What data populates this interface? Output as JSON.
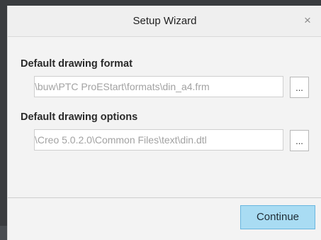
{
  "dialog": {
    "title": "Setup Wizard",
    "close_glyph": "×",
    "format_label": "Default drawing format",
    "format_value": "\\buw\\PTC ProEStart\\formats\\din_a4.frm",
    "options_label": "Default drawing options",
    "options_value": "\\Creo 5.0.2.0\\Common Files\\text\\din.dtl",
    "browse_label": "...",
    "continue_label": "Continue"
  },
  "colors": {
    "accent_button": "#a9dcf3",
    "accent_border": "#6ab6df"
  },
  "icons": {
    "close": "close-icon"
  }
}
